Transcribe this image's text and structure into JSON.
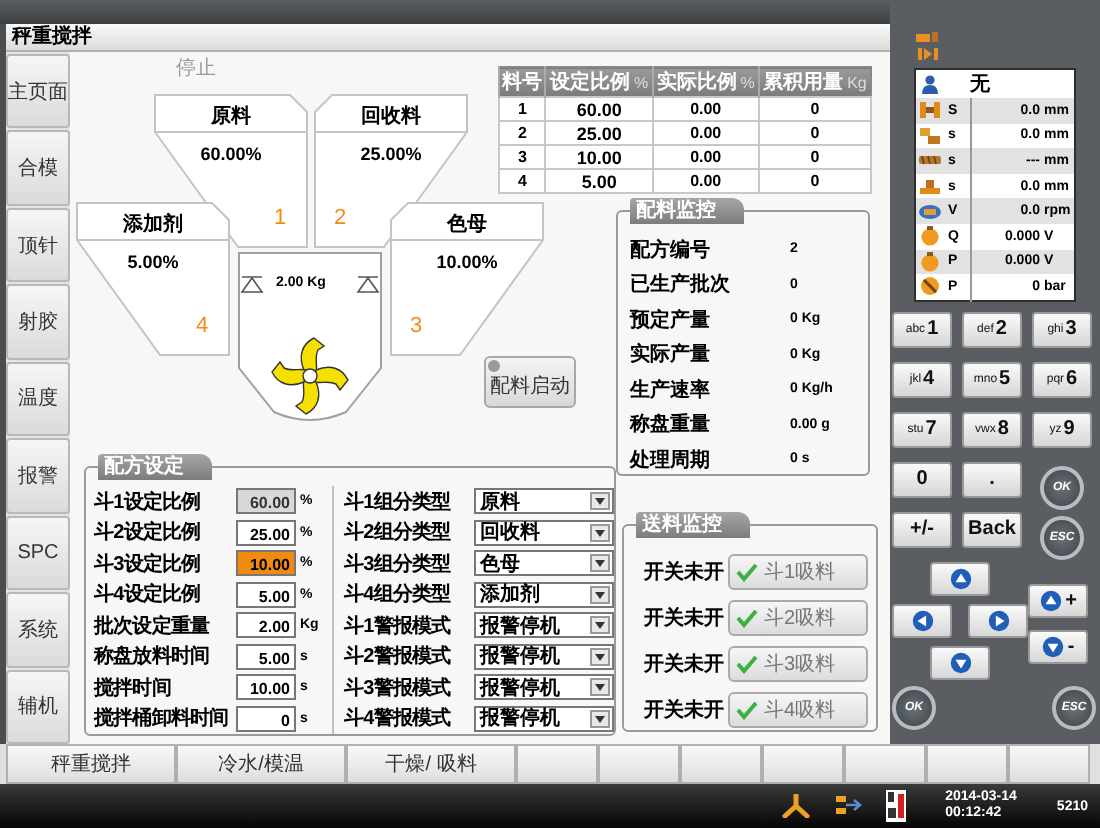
{
  "window": {
    "title": "秤重搅拌"
  },
  "sidebar": {
    "items": [
      "主页面",
      "合模",
      "顶针",
      "射胶",
      "温度",
      "报警",
      "SPC",
      "系统",
      "辅机"
    ]
  },
  "status": "停止",
  "hoppers": [
    {
      "name": "原料",
      "ratio": "60.00%",
      "number": "1"
    },
    {
      "name": "回收料",
      "ratio": "25.00%",
      "number": "2"
    },
    {
      "name": "添加剂",
      "ratio": "5.00%",
      "number": "4"
    },
    {
      "name": "色母",
      "ratio": "10.00%",
      "number": "3"
    }
  ],
  "mixer": {
    "weight": "2.00 Kg"
  },
  "start_button": "配料启动",
  "ratio_table": {
    "columns": [
      {
        "label": "料号"
      },
      {
        "label": "设定比例",
        "unit": "%"
      },
      {
        "label": "实际比例",
        "unit": "%"
      },
      {
        "label": "累积用量",
        "unit": "Kg"
      }
    ],
    "rows": [
      [
        "1",
        "60.00",
        "0.00",
        "0"
      ],
      [
        "2",
        "25.00",
        "0.00",
        "0"
      ],
      [
        "3",
        "10.00",
        "0.00",
        "0"
      ],
      [
        "4",
        "5.00",
        "0.00",
        "0"
      ]
    ]
  },
  "batch_monitor": {
    "title": "配料监控",
    "rows": [
      {
        "label": "配方编号",
        "value": "2"
      },
      {
        "label": "已生产批次",
        "value": "0"
      },
      {
        "label": "预定产量",
        "value": "0 Kg"
      },
      {
        "label": "实际产量",
        "value": "0 Kg"
      },
      {
        "label": "生产速率",
        "value": "0 Kg/h"
      },
      {
        "label": "称盘重量",
        "value": "0.00 g"
      },
      {
        "label": "处理周期",
        "value": "0 s"
      }
    ]
  },
  "recipe": {
    "title": "配方设定",
    "settings": [
      {
        "label": "斗1设定比例",
        "value": "60.00",
        "unit": "%",
        "disabled": true,
        "selected": false
      },
      {
        "label": "斗2设定比例",
        "value": "25.00",
        "unit": "%",
        "disabled": false,
        "selected": false
      },
      {
        "label": "斗3设定比例",
        "value": "10.00",
        "unit": "%",
        "disabled": false,
        "selected": true
      },
      {
        "label": "斗4设定比例",
        "value": "5.00",
        "unit": "%",
        "disabled": false,
        "selected": false
      },
      {
        "label": "批次设定重量",
        "value": "2.00",
        "unit": "Kg",
        "disabled": false,
        "selected": false
      },
      {
        "label": "称盘放料时间",
        "value": "5.00",
        "unit": "s",
        "disabled": false,
        "selected": false
      },
      {
        "label": "搅拌时间",
        "value": "10.00",
        "unit": "s",
        "disabled": false,
        "selected": false
      },
      {
        "label": "搅拌桶卸料时间",
        "value": "0",
        "unit": "s",
        "disabled": false,
        "selected": false
      }
    ],
    "options": [
      {
        "label": "斗1组分类型",
        "value": "原料"
      },
      {
        "label": "斗2组分类型",
        "value": "回收料"
      },
      {
        "label": "斗3组分类型",
        "value": "色母"
      },
      {
        "label": "斗4组分类型",
        "value": "添加剂"
      },
      {
        "label": "斗1警报模式",
        "value": "报警停机"
      },
      {
        "label": "斗2警报模式",
        "value": "报警停机"
      },
      {
        "label": "斗3警报模式",
        "value": "报警停机"
      },
      {
        "label": "斗4警报模式",
        "value": "报警停机"
      }
    ]
  },
  "feed_monitor": {
    "title": "送料监控",
    "rows": [
      {
        "status": "开关未开",
        "button": "斗1吸料"
      },
      {
        "status": "开关未开",
        "button": "斗2吸料"
      },
      {
        "status": "开关未开",
        "button": "斗3吸料"
      },
      {
        "status": "开关未开",
        "button": "斗4吸料"
      }
    ]
  },
  "machine_status": [
    {
      "kind": "operator",
      "value": "无"
    },
    {
      "kind": "mold",
      "symbol": "S",
      "value": "0.0",
      "unit": "mm"
    },
    {
      "kind": "ejector",
      "symbol": "s",
      "value": "0.0",
      "unit": "mm"
    },
    {
      "kind": "screw",
      "symbol": "s",
      "value": "---",
      "unit": "mm"
    },
    {
      "kind": "nozzle",
      "symbol": "s",
      "value": "0.0",
      "unit": "mm"
    },
    {
      "kind": "motor",
      "symbol": "V",
      "value": "0.0",
      "unit": "rpm"
    },
    {
      "kind": "valve",
      "symbol": "Q",
      "value": "0.000",
      "unit": "V"
    },
    {
      "kind": "valve",
      "symbol": "P",
      "value": "0.000",
      "unit": "V"
    },
    {
      "kind": "gauge",
      "symbol": "P",
      "value": "0",
      "unit": "bar"
    }
  ],
  "keypad": {
    "keys": [
      {
        "kind": "digit",
        "letters": "abc",
        "label": "1"
      },
      {
        "kind": "digit",
        "letters": "def",
        "label": "2"
      },
      {
        "kind": "digit",
        "letters": "ghi",
        "label": "3"
      },
      {
        "kind": "digit",
        "letters": "jkl",
        "label": "4"
      },
      {
        "kind": "digit",
        "letters": "mno",
        "label": "5"
      },
      {
        "kind": "digit",
        "letters": "pqr",
        "label": "6"
      },
      {
        "kind": "digit",
        "letters": "stu",
        "label": "7"
      },
      {
        "kind": "digit",
        "letters": "vwx",
        "label": "8"
      },
      {
        "kind": "digit",
        "letters": "yz",
        "label": "9"
      },
      {
        "kind": "key",
        "label": "0"
      },
      {
        "kind": "key",
        "label": "."
      },
      {
        "kind": "round",
        "label": "OK"
      },
      {
        "kind": "key",
        "label": "+/-"
      },
      {
        "kind": "key",
        "label": "Back"
      },
      {
        "kind": "round",
        "label": "ESC"
      }
    ]
  },
  "nav_pad": {
    "increase": "+",
    "decrease": "-",
    "ok": "OK",
    "escape": "ESC"
  },
  "bottom_tabs": [
    "秤重搅拌",
    "冷水/模温",
    "干燥/ 吸料"
  ],
  "status_bar": {
    "date": "2014-03-14",
    "time": "00:12:42",
    "code": "5210"
  }
}
